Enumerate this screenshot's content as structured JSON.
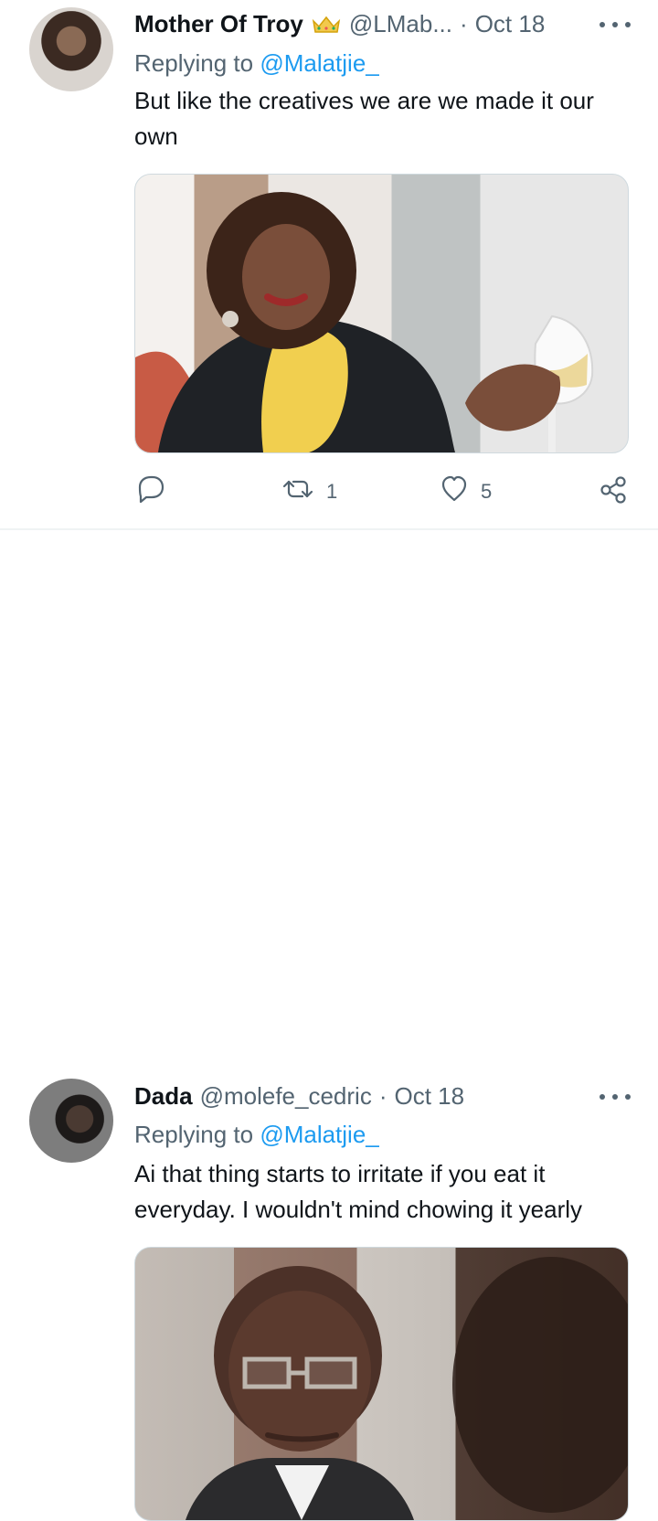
{
  "tweets": [
    {
      "display_name": "Mother Of Troy",
      "crown_icon": "crown-icon",
      "handle": "@LMab...",
      "separator": "·",
      "date": "Oct 18",
      "replying_prefix": "Replying to ",
      "replying_to": "@Malatjie_",
      "text": "But like the creatives we are we made it our own",
      "actions": {
        "reply": "",
        "retweet": "1",
        "like": "5",
        "share": ""
      }
    },
    {
      "display_name": "Dada",
      "handle": "@molefe_cedric",
      "separator": "·",
      "date": "Oct 18",
      "replying_prefix": "Replying to ",
      "replying_to": "@Malatjie_",
      "text": "Ai that thing starts to irritate if you eat it everyday. I wouldn't mind chowing it yearly"
    }
  ],
  "colors": {
    "text_primary": "#0f1419",
    "text_secondary": "#536471",
    "link": "#1d9bf0",
    "divider": "#eff3f4",
    "media_border": "#cfd9de"
  },
  "icons": [
    "more-icon",
    "reply-icon",
    "retweet-icon",
    "like-icon",
    "share-icon"
  ]
}
